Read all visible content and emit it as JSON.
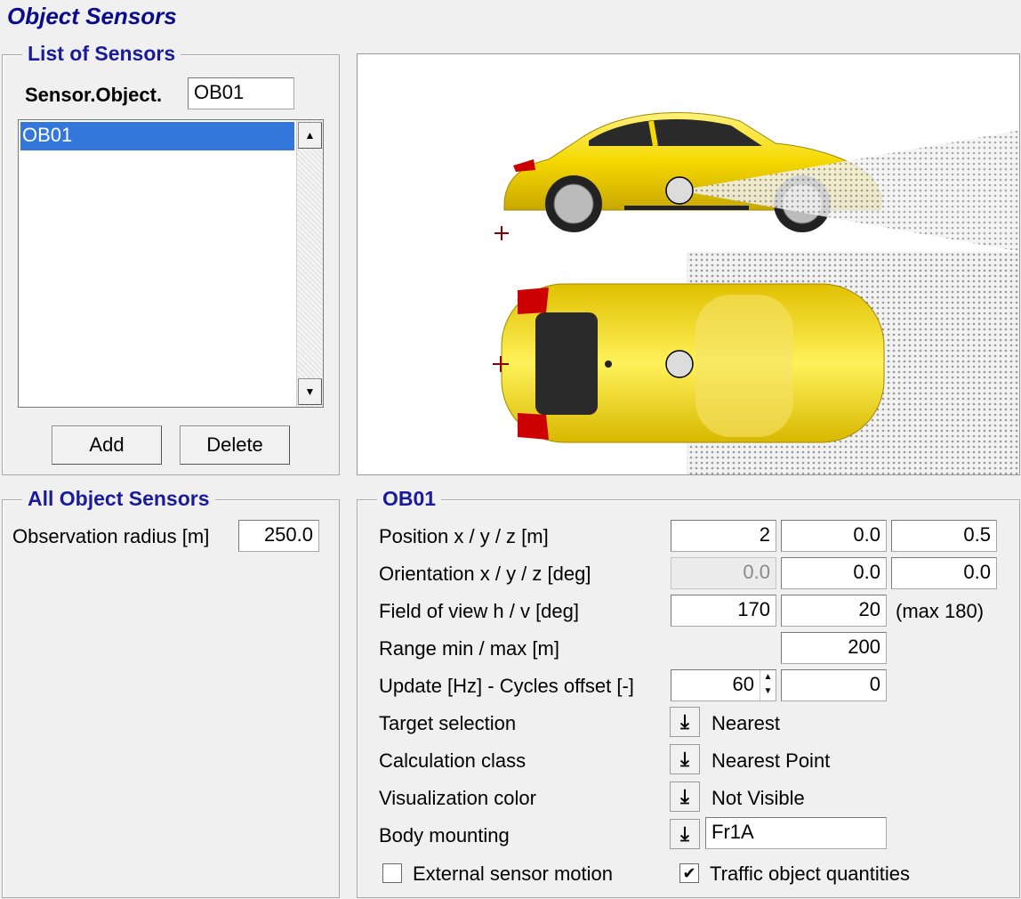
{
  "window_title": "Object Sensors",
  "list_group": {
    "title": "List of Sensors",
    "sensor_object_label": "Sensor.Object.",
    "sensor_object_value": "OB01",
    "items": [
      "OB01"
    ],
    "selected_index": 0,
    "add_label": "Add",
    "delete_label": "Delete"
  },
  "all_group": {
    "title": "All Object Sensors",
    "radius_label": "Observation radius [m]",
    "radius_value": "250.0"
  },
  "sensor_group": {
    "title": "OB01",
    "position": {
      "label": "Position x / y / z [m]",
      "x": "2",
      "y": "0.0",
      "z": "0.5"
    },
    "orientation": {
      "label": "Orientation x / y / z [deg]",
      "x": "0.0",
      "y": "0.0",
      "z": "0.0"
    },
    "fov": {
      "label": "Field of view h / v [deg]",
      "h": "170",
      "v": "20",
      "note": "(max 180)"
    },
    "range": {
      "label": "Range min / max [m]",
      "max": "200"
    },
    "update": {
      "label": "Update [Hz] - Cycles offset [-]",
      "hz": "60",
      "offset": "0"
    },
    "target_selection": {
      "label": "Target selection",
      "value": "Nearest"
    },
    "calc_class": {
      "label": "Calculation class",
      "value": "Nearest Point"
    },
    "vis_color": {
      "label": "Visualization color",
      "value": "Not Visible"
    },
    "body_mounting": {
      "label": "Body mounting",
      "value": "Fr1A"
    },
    "external_motion": {
      "label": "External sensor motion",
      "checked": false
    },
    "traffic_quantities": {
      "label": "Traffic object quantities",
      "checked": true
    }
  },
  "colors": {
    "title": "#0a0a8c",
    "legend": "#1a1a9c",
    "selection": "#3377dd",
    "car_body": "#f5d800"
  }
}
